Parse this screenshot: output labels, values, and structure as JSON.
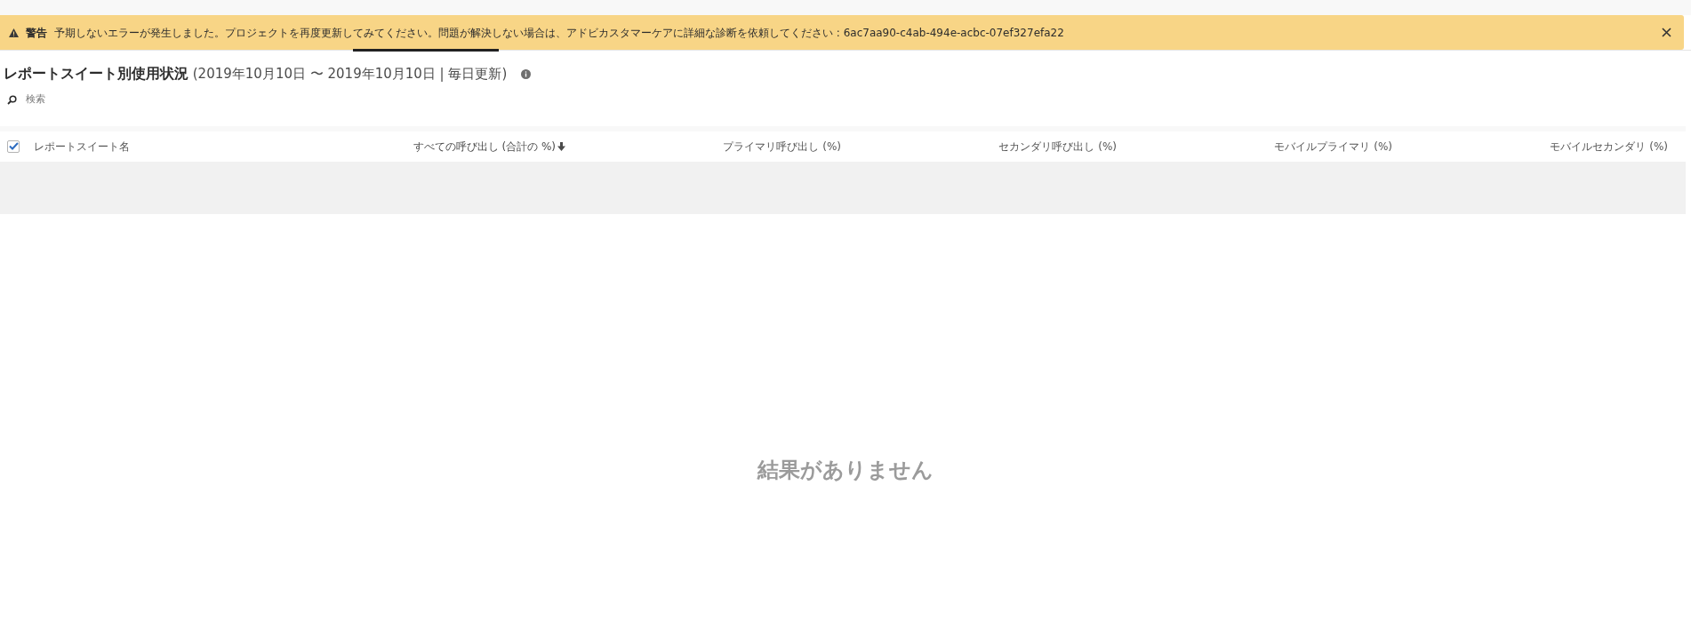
{
  "alert": {
    "label": "警告",
    "message": "予期しないエラーが発生しました。プロジェクトを再度更新してみてください。問題が解決しない場合は、アドビカスタマーケアに詳細な診断を依頼してください : 6ac7aa90-c4ab-494e-acbc-07ef327efa22"
  },
  "heading": {
    "title": "レポートスイート別使用状況",
    "subtitle": "(2019年10月10日 〜 2019年10月10日 | 毎日更新)"
  },
  "search": {
    "placeholder": "検索"
  },
  "table": {
    "select_all_checked": true,
    "columns": [
      {
        "label": "レポートスイート名",
        "sorted": false
      },
      {
        "label": "すべての呼び出し (合計の %)",
        "sorted": true
      },
      {
        "label": "プライマリ呼び出し (%)",
        "sorted": false
      },
      {
        "label": "セカンダリ呼び出し (%)",
        "sorted": false
      },
      {
        "label": "モバイルプライマリ (%)",
        "sorted": false
      },
      {
        "label": "モバイルセカンダリ (%)",
        "sorted": false
      }
    ],
    "empty_message": "結果がありません"
  }
}
